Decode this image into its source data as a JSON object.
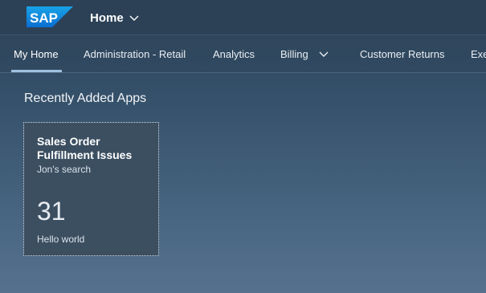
{
  "shell": {
    "logo_text": "SAP",
    "title": "Home",
    "title_icon": "chevron-down-icon",
    "brand_color": "#0a6ed1"
  },
  "tabs": [
    {
      "label": "My Home",
      "active": true
    },
    {
      "label": "Administration - Retail"
    },
    {
      "label": "Analytics"
    },
    {
      "label": "Billing",
      "icon": "chevron-down-icon"
    },
    {
      "label": "Customer Returns"
    },
    {
      "label": "Exe"
    }
  ],
  "section": {
    "title": "Recently Added Apps"
  },
  "tiles": [
    {
      "title": "Sales Order Fulfillment Issues",
      "subtitle": "Jon's search",
      "count": "31",
      "footer": "Hello world"
    }
  ]
}
